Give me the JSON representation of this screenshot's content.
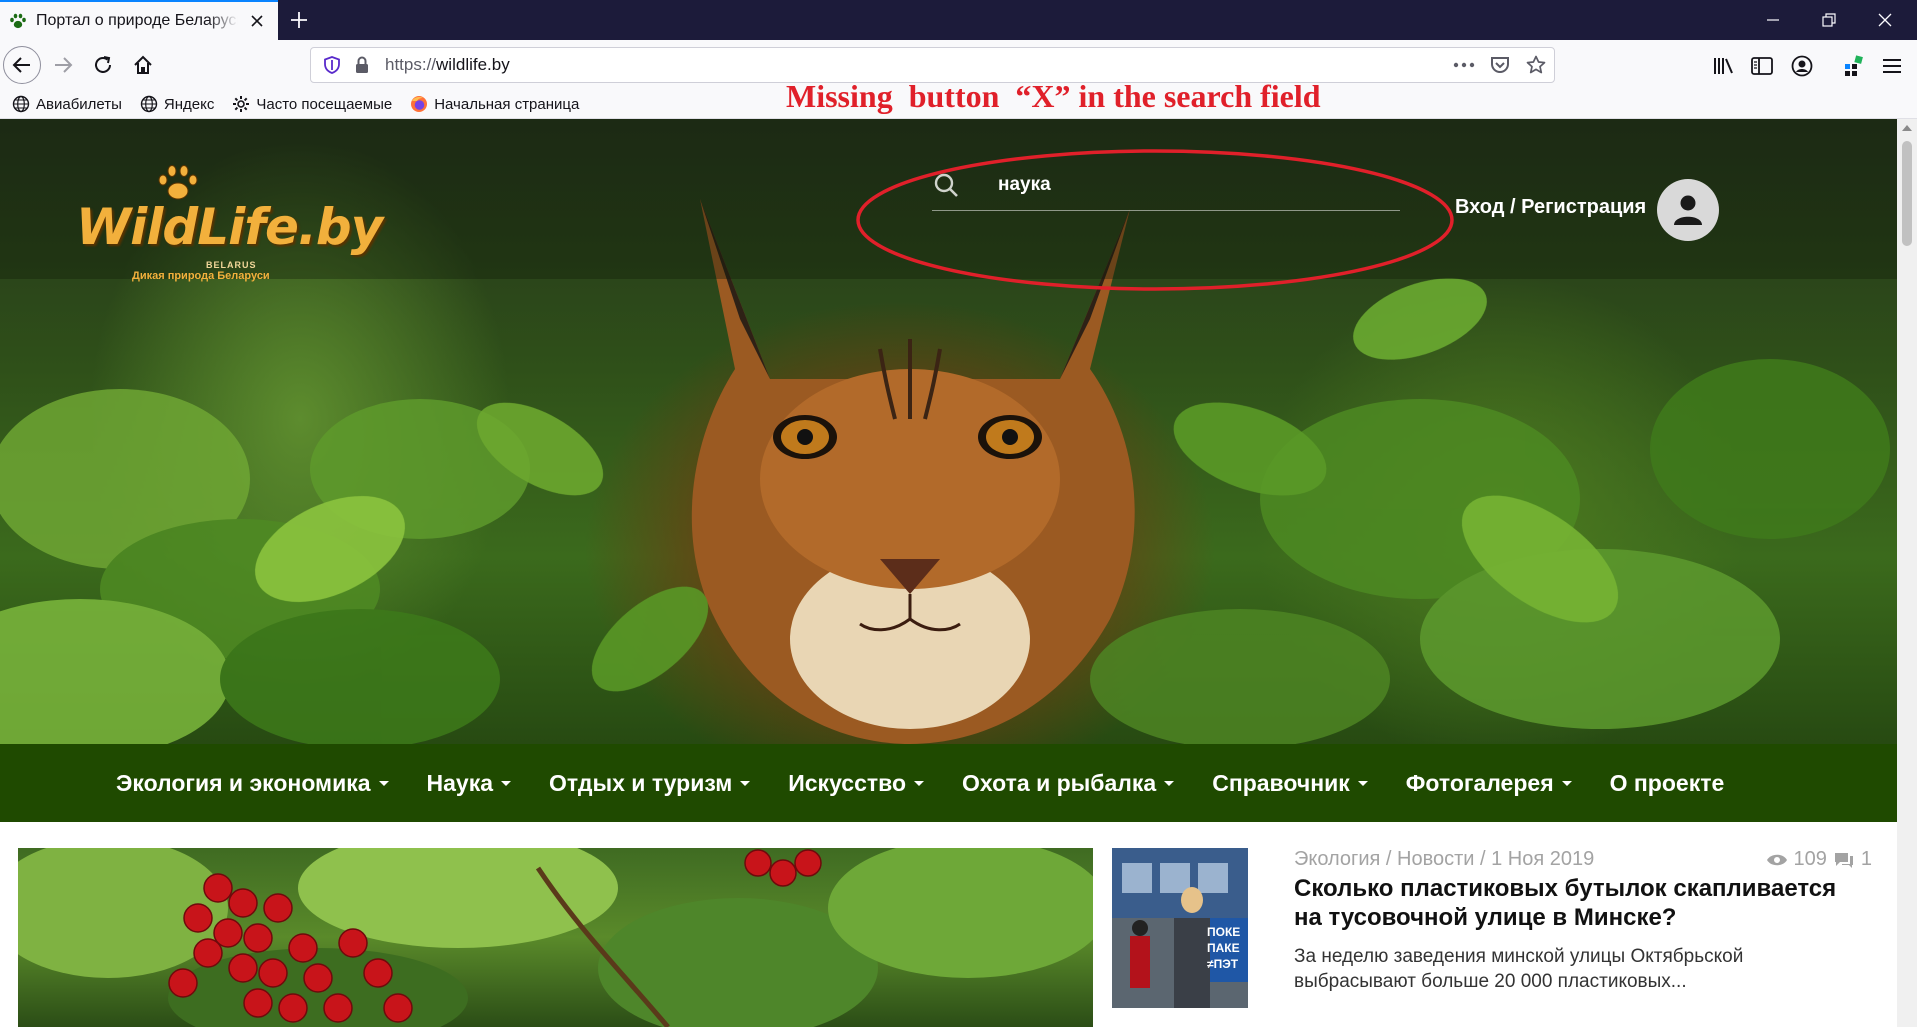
{
  "browser": {
    "tab_title": "Портал о природе Беларуси",
    "url_protocol": "https://",
    "url_host": "wildlife.by",
    "bookmarks": [
      {
        "label": "Авиабилеты",
        "icon": "globe-icon"
      },
      {
        "label": "Яндекс",
        "icon": "globe-icon"
      },
      {
        "label": "Часто посещаемые",
        "icon": "gear-icon"
      },
      {
        "label": "Начальная страница",
        "icon": "firefox-icon"
      }
    ]
  },
  "annotation": {
    "text": "Missing  button  “X” in the search field",
    "color": "#e0202a"
  },
  "site": {
    "logo_text": "WildLife.by",
    "logo_country": "BELARUS",
    "logo_tagline": "Дикая природа Беларуси",
    "search_value": "наука",
    "login_label": "Вход / Регистрация",
    "nav": [
      "Экология и экономика",
      "Наука",
      "Отдых и туризм",
      "Искусство",
      "Охота и рыбалка",
      "Справочник",
      "Фотогалерея",
      "О проекте"
    ],
    "nav_has_dropdown": [
      true,
      true,
      true,
      true,
      true,
      true,
      true,
      false
    ],
    "colors": {
      "nav_bg": "#1f4a00",
      "logo": "#f2b03c"
    }
  },
  "news": {
    "meta": "Экология / Новости / 1 Ноя 2019",
    "views": "109",
    "comments": "1",
    "title": "Сколько пластиковых бутылок скапливается на тусовочной улице в Минске?",
    "excerpt": "За неделю заведения минской улицы Октябрьской выбрасывают больше 20 000 пластиковых...",
    "thumb_sign": "ПОКЕ ПАКЕ ≠ПЭТ"
  }
}
